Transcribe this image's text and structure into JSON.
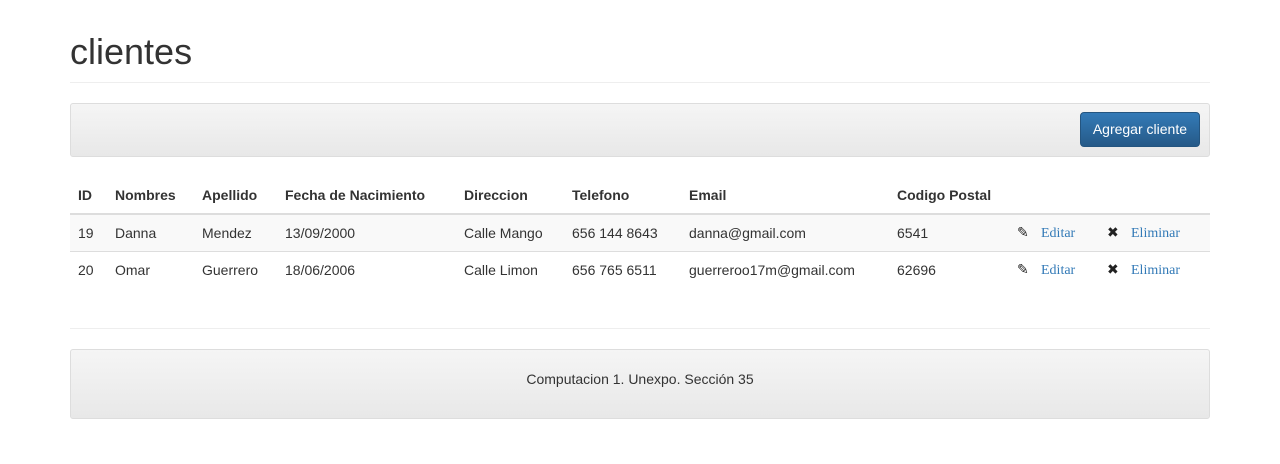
{
  "header": {
    "title": "clientes"
  },
  "toolbar": {
    "add_label": "Agregar cliente"
  },
  "table": {
    "columns": [
      "ID",
      "Nombres",
      "Apellido",
      "Fecha de Nacimiento",
      "Direccion",
      "Telefono",
      "Email",
      "Codigo Postal",
      "",
      ""
    ],
    "rows": [
      {
        "id": "19",
        "nombres": "Danna",
        "apellido": "Mendez",
        "fecha": "13/09/2000",
        "direccion": "Calle Mango",
        "telefono": "656 144 8643",
        "email": "danna@gmail.com",
        "cp": "6541",
        "edit_label": "Editar",
        "delete_label": "Eliminar",
        "edit_icon": "✎",
        "delete_icon": "✖"
      },
      {
        "id": "20",
        "nombres": "Omar",
        "apellido": "Guerrero",
        "fecha": "18/06/2006",
        "direccion": "Calle Limon",
        "telefono": "656 765 6511",
        "email": "guerreroo17m@gmail.com",
        "cp": "62696",
        "edit_label": "Editar",
        "delete_label": "Eliminar",
        "edit_icon": "✎",
        "delete_icon": "✖"
      }
    ]
  },
  "footer": {
    "text": "Computacion 1. Unexpo. Sección 35"
  },
  "colors": {
    "primary": "#337ab7",
    "link": "#337ab7",
    "panel": "#f5f5f5"
  },
  "icons": {
    "edit": "edit-icon",
    "delete": "remove-icon"
  }
}
